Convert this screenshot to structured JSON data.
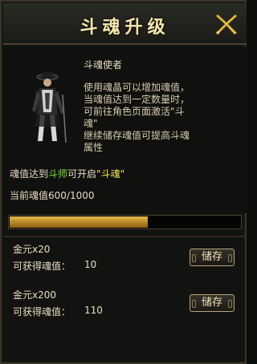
{
  "window": {
    "title": "斗魂升级"
  },
  "spirit": {
    "name": "斗魂使者",
    "description_lines": [
      "使用魂晶可以增加魂值，",
      "当魂值达到一定数量时，",
      "可前往角色页面激活\"斗",
      "魂\"",
      "继续储存魂值可提高斗魂",
      "属性"
    ]
  },
  "unlock": {
    "prefix": "魂值达到",
    "rank": "斗师",
    "middle": "可开启",
    "target": "\"斗魂\""
  },
  "current": {
    "text": "当前魂值600/1000",
    "value": 600,
    "max": 1000
  },
  "progress": {
    "fraction": 0.6,
    "fill_color": "#c99a34"
  },
  "options": [
    {
      "cost": "金元x20",
      "gain_label": "可获得魂值：",
      "gain": "10",
      "button": "储存"
    },
    {
      "cost": "金元x200",
      "gain_label": "可获得魂值：",
      "gain": "110",
      "button": "储存"
    }
  ],
  "icons": {
    "close": "close-x-icon",
    "portrait": "spirit-envoy-portrait"
  }
}
